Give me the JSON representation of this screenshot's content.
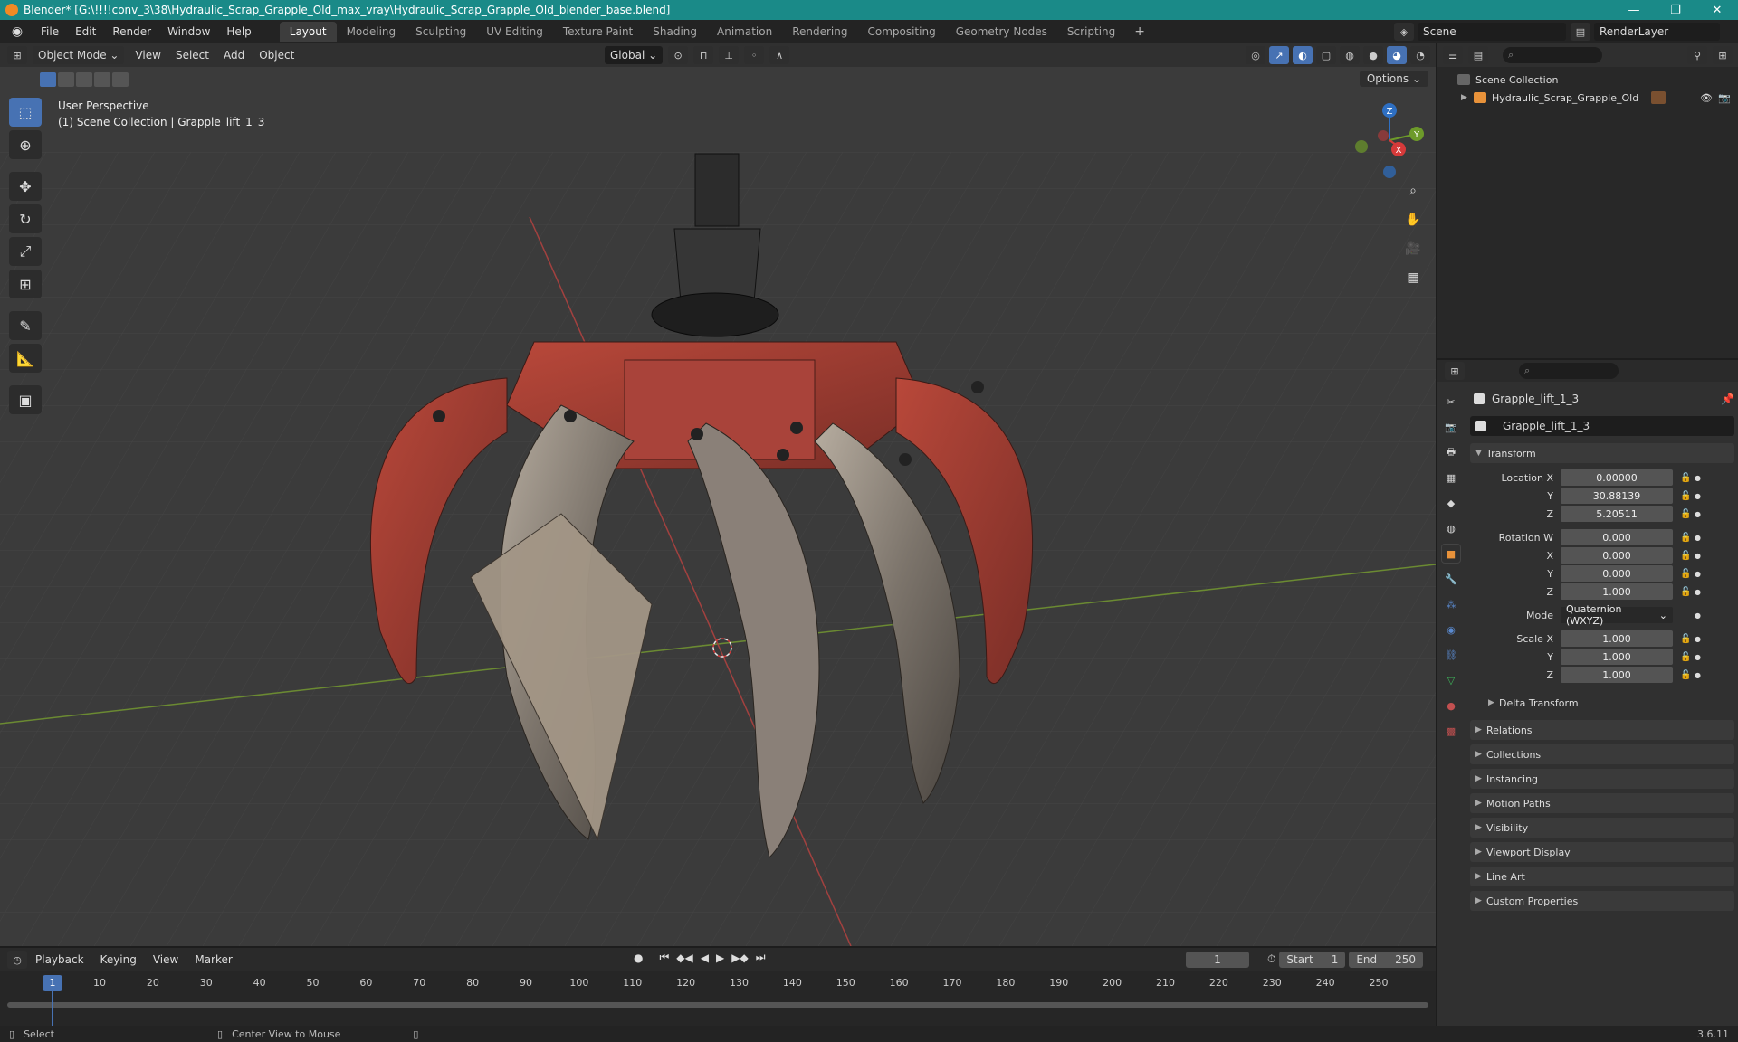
{
  "window": {
    "title": "Blender* [G:\\!!!!conv_3\\38\\Hydraulic_Scrap_Grapple_Old_max_vray\\Hydraulic_Scrap_Grapple_Old_blender_base.blend]",
    "minimize": "—",
    "maximize": "❐",
    "close": "✕"
  },
  "menu": {
    "items": [
      "File",
      "Edit",
      "Render",
      "Window",
      "Help"
    ]
  },
  "workspaces": [
    "Layout",
    "Modeling",
    "Sculpting",
    "UV Editing",
    "Texture Paint",
    "Shading",
    "Animation",
    "Rendering",
    "Compositing",
    "Geometry Nodes",
    "Scripting"
  ],
  "workspace_add": "+",
  "scene": {
    "name": "Scene",
    "render_layer": "RenderLayer"
  },
  "viewport": {
    "mode": "Object Mode",
    "menus": [
      "View",
      "Select",
      "Add",
      "Object"
    ],
    "orientation": "Global",
    "options": "Options",
    "perspective": "User Perspective",
    "context": "(1) Scene Collection | Grapple_lift_1_3",
    "gizmo": {
      "x": "X",
      "y": "Y",
      "z": "Z"
    }
  },
  "outliner": {
    "root": "Scene Collection",
    "object": "Hydraulic_Scrap_Grapple_Old"
  },
  "properties": {
    "object_name": "Grapple_lift_1_3",
    "data_name": "Grapple_lift_1_3",
    "transform_title": "Transform",
    "location": {
      "label": "Location X",
      "x": "0.00000",
      "y": "30.88139",
      "z": "5.20511"
    },
    "rotation": {
      "label": "Rotation W",
      "w": "0.000",
      "x": "0.000",
      "y": "0.000",
      "z": "1.000"
    },
    "mode_label": "Mode",
    "mode_value": "Quaternion (WXYZ)",
    "scale": {
      "label": "Scale X",
      "x": "1.000",
      "y": "1.000",
      "z": "1.000"
    },
    "axis_y": "Y",
    "axis_z": "Z",
    "axis_x": "X",
    "delta": "Delta Transform",
    "panels": [
      "Relations",
      "Collections",
      "Instancing",
      "Motion Paths",
      "Visibility",
      "Viewport Display",
      "Line Art",
      "Custom Properties"
    ]
  },
  "timeline": {
    "menus": [
      "Playback",
      "Keying",
      "View",
      "Marker"
    ],
    "current_frame": "1",
    "start_label": "Start",
    "start": "1",
    "end_label": "End",
    "end": "250",
    "ticks": [
      "10",
      "20",
      "30",
      "40",
      "50",
      "60",
      "70",
      "80",
      "90",
      "100",
      "110",
      "120",
      "130",
      "140",
      "150",
      "160",
      "170",
      "180",
      "190",
      "200",
      "210",
      "220",
      "230",
      "240",
      "250"
    ],
    "cursor": "1"
  },
  "status": {
    "select": "Select",
    "center": "Center View to Mouse",
    "version": "3.6.11"
  }
}
